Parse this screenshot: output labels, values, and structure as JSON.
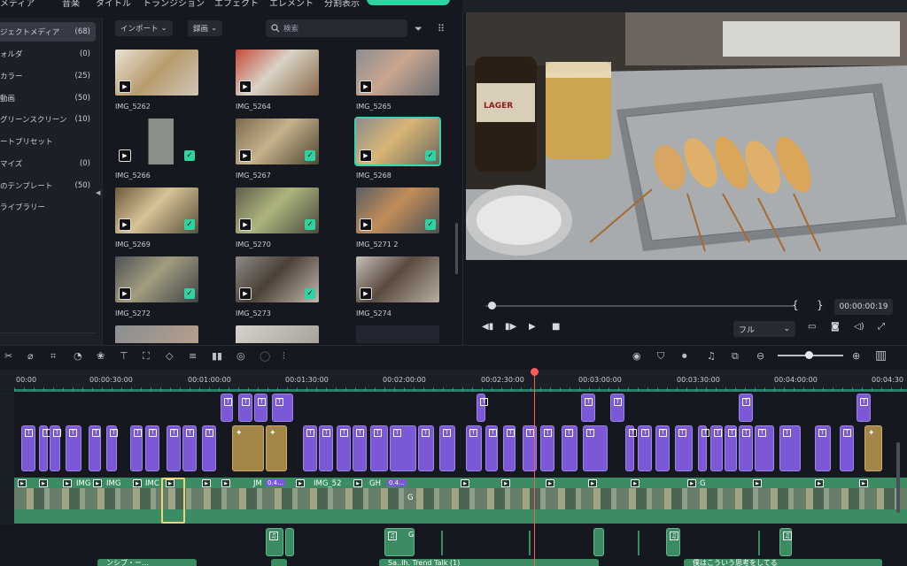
{
  "menu_tabs": [
    "メディア",
    "音楽",
    "タイトル",
    "トランジション",
    "エフェクト",
    "エレメント",
    "分割表示"
  ],
  "sidebar": {
    "items": [
      {
        "label": "ジェクトメディア",
        "count": "(68)",
        "active": true
      },
      {
        "label": "ォルダ",
        "count": "(0)"
      },
      {
        "label": "カラー",
        "count": "(25)"
      },
      {
        "label": "動画",
        "count": "(50)"
      },
      {
        "label": "グリーンスクリーン",
        "count": "(10)"
      },
      {
        "label": "ートプリセット",
        "count": ""
      },
      {
        "label": "マイズ",
        "count": "(0)"
      },
      {
        "label": "のテンプレート",
        "count": "(50)"
      },
      {
        "label": "ライブラリー",
        "count": ""
      }
    ]
  },
  "media_toolbar": {
    "import_label": "インポート",
    "record_label": "録画",
    "search_placeholder": "検索"
  },
  "media": [
    {
      "name": "IMG_5262",
      "checked": false,
      "selected": false
    },
    {
      "name": "IMG_5264",
      "checked": false,
      "selected": false
    },
    {
      "name": "IMG_5265",
      "checked": false,
      "selected": false
    },
    {
      "name": "IMG_5266",
      "checked": true,
      "selected": false
    },
    {
      "name": "IMG_5267",
      "checked": true,
      "selected": false
    },
    {
      "name": "IMG_5268",
      "checked": true,
      "selected": true
    },
    {
      "name": "IMG_5269",
      "checked": true,
      "selected": false
    },
    {
      "name": "IMG_5270",
      "checked": true,
      "selected": false
    },
    {
      "name": "IMG_5271 2",
      "checked": true,
      "selected": false
    },
    {
      "name": "IMG_5272",
      "checked": true,
      "selected": false
    },
    {
      "name": "IMG_5273",
      "checked": true,
      "selected": false
    },
    {
      "name": "IMG_5274",
      "checked": false,
      "selected": false
    }
  ],
  "preview": {
    "timecode": "00:00:00:19",
    "fit_label": "フル",
    "progress": 0.02
  },
  "ruler": {
    "labels": [
      "00:00",
      "00:00:30:00",
      "00:01:00:00",
      "00:01:30:00",
      "00:02:00:00",
      "00:02:30:00",
      "00:03:00:00",
      "00:03:30:00",
      "00:04:00:00",
      "00:04:30"
    ]
  },
  "video_track_labels": [
    "IMG",
    "IMG",
    "IMC",
    "JM",
    "IMG_52",
    "GH",
    "G",
    "G"
  ],
  "badge_labels": [
    "0.4...",
    "0.4..."
  ],
  "audio_labels": [
    "G"
  ],
  "music_labels": [
    "ンシブ・ー…",
    "Sa..Ih. Trend Talk (1)",
    "僕はこういう思考をしてる"
  ],
  "colors": {
    "accent": "#2fd3a2",
    "title_clip": "#7a58d6",
    "video_clip": "#3b8c63",
    "playhead": "#ff5a5a"
  }
}
